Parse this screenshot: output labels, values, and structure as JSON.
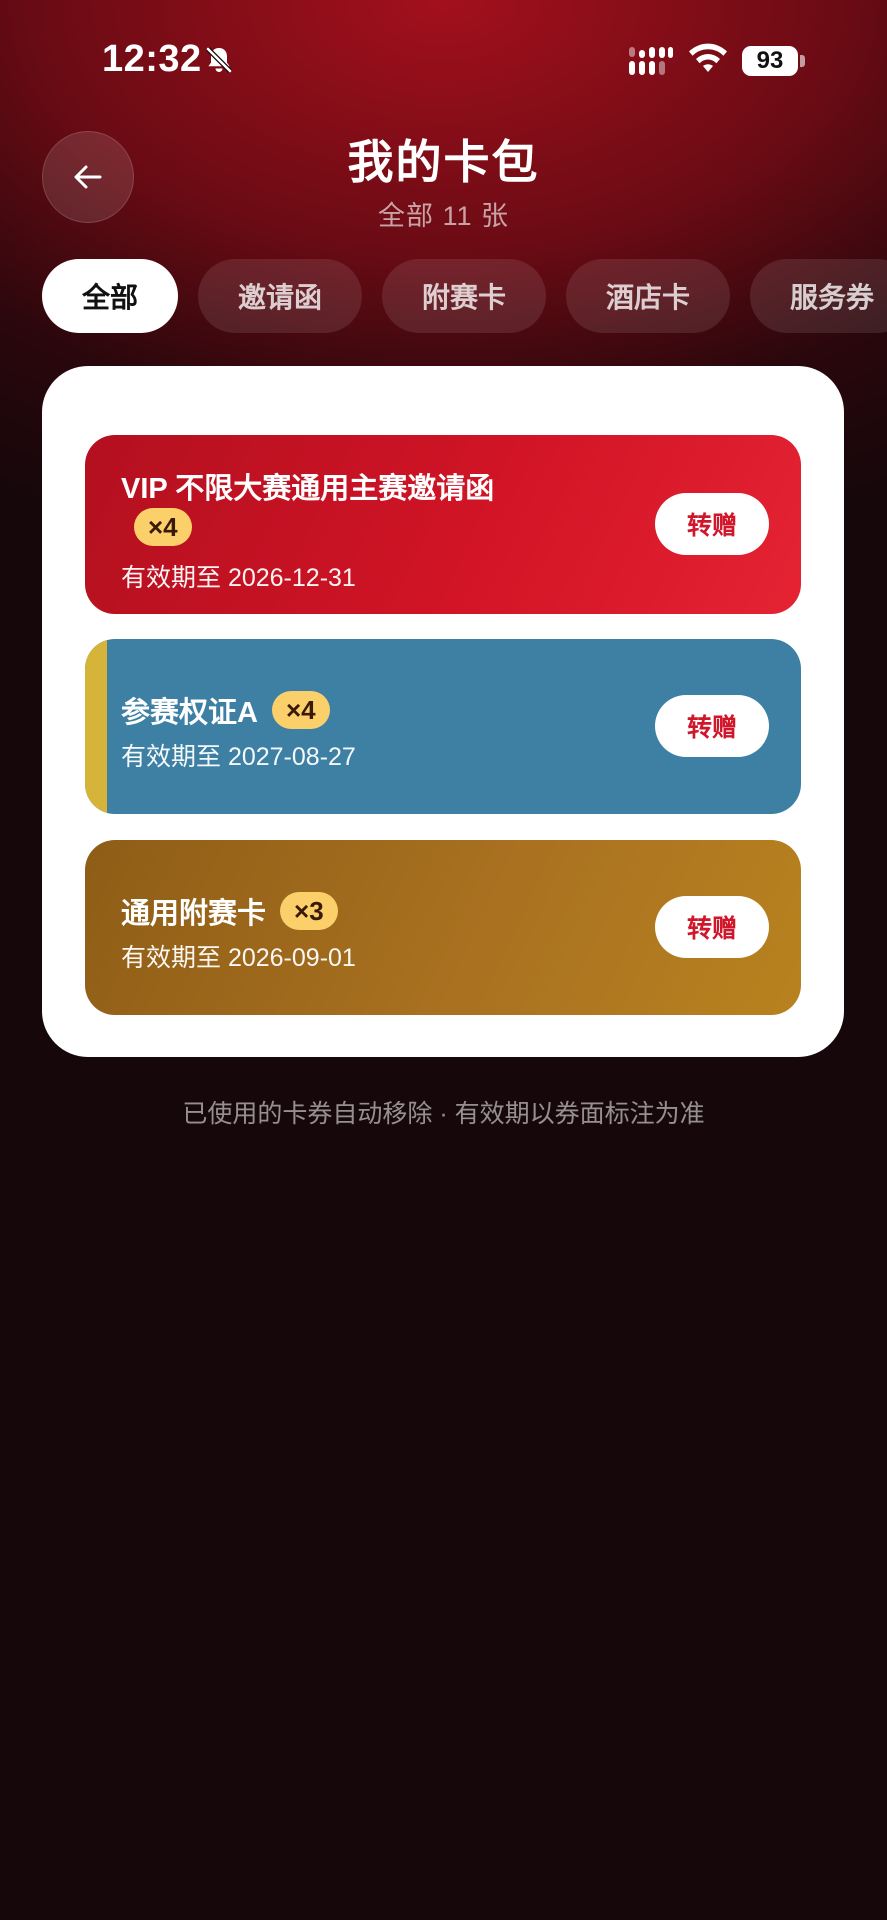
{
  "status_bar": {
    "time": "12:32",
    "battery": "93",
    "icons": [
      "bell-muted-icon",
      "signal-icon",
      "wifi-icon",
      "battery-icon"
    ]
  },
  "header": {
    "back_icon": "arrow-left-icon",
    "title": "我的卡包",
    "subtitle": "全部 11 张"
  },
  "tabs": [
    {
      "label": "全部",
      "active": true
    },
    {
      "label": "邀请函",
      "active": false
    },
    {
      "label": "附赛卡",
      "active": false
    },
    {
      "label": "酒店卡",
      "active": false
    },
    {
      "label": "服务券",
      "active": false
    }
  ],
  "cards": [
    {
      "title": "VIP 不限大赛通用主赛邀请函",
      "count": "×4",
      "validity": "有效期至 2026-12-31",
      "action": "转赠",
      "color": "#d11426"
    },
    {
      "title": "参赛权证A",
      "count": "×4",
      "validity": "有效期至 2027-08-27",
      "action": "转赠",
      "color": "#3d80a4"
    },
    {
      "title": "通用附赛卡",
      "count": "×3",
      "validity": "有效期至 2026-09-01",
      "action": "转赠",
      "color": "#a97120"
    }
  ],
  "footer": {
    "note": "已使用的卡券自动移除 · 有效期以券面标注为准"
  },
  "colors": {
    "accent": "#d0162a",
    "count_badge": "#fbd06b"
  }
}
